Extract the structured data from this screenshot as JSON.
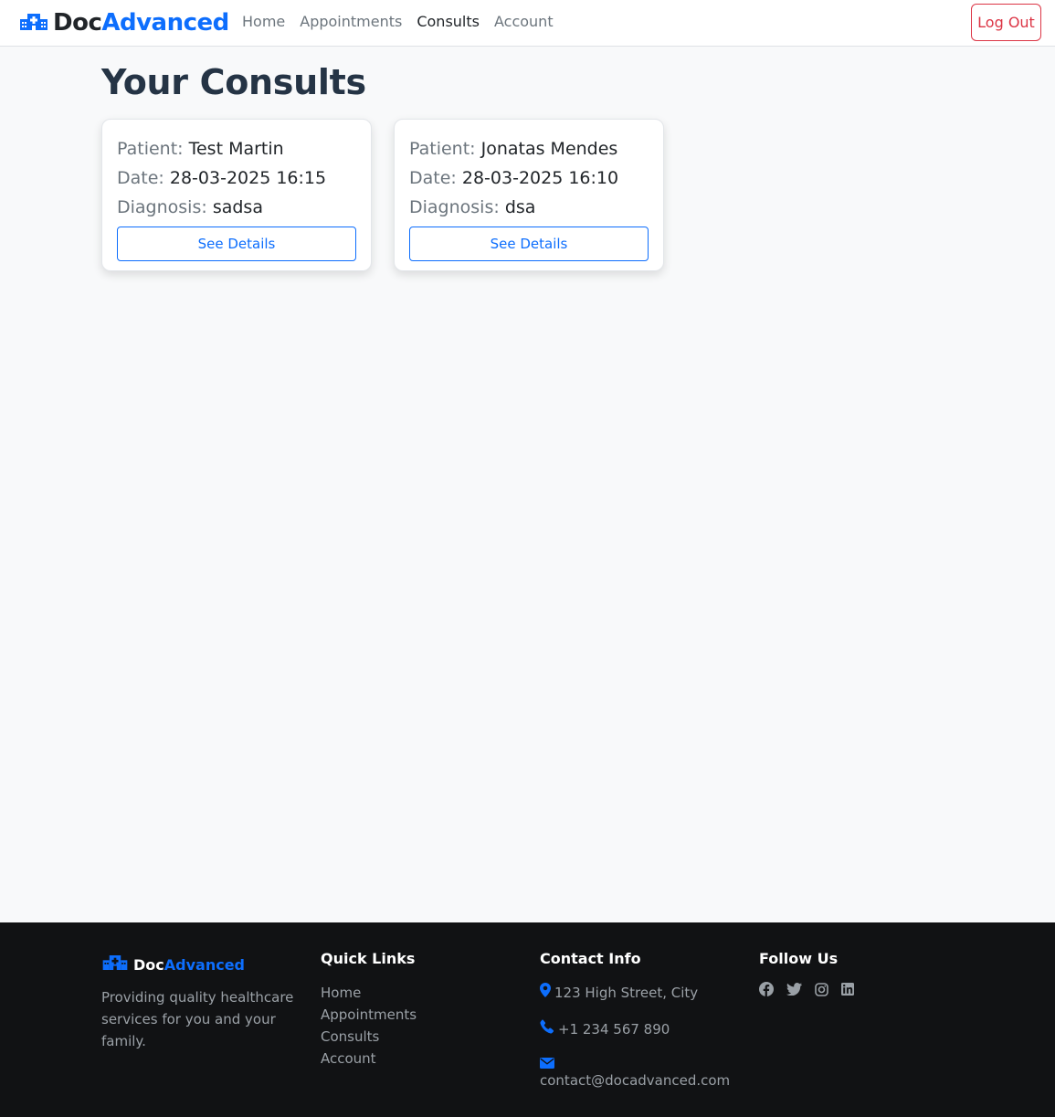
{
  "navbar": {
    "brand_part1": "Doc",
    "brand_part2": "Advanced",
    "links": [
      {
        "label": "Home"
      },
      {
        "label": "Appointments"
      },
      {
        "label": "Consults"
      },
      {
        "label": "Account"
      }
    ],
    "logout_label": "Log Out"
  },
  "main": {
    "title": "Your Consults",
    "cards": [
      {
        "patient_label": "Patient:",
        "patient": "Test Martin",
        "date_label": "Date:",
        "date": "28-03-2025 16:15",
        "diagnosis_label": "Diagnosis:",
        "diagnosis": "sadsa",
        "button_label": "See Details"
      },
      {
        "patient_label": "Patient:",
        "patient": "Jonatas Mendes",
        "date_label": "Date:",
        "date": "28-03-2025 16:10",
        "diagnosis_label": "Diagnosis:",
        "diagnosis": "dsa",
        "button_label": "See Details"
      }
    ]
  },
  "footer": {
    "brand_part1": "Doc",
    "brand_part2": "Advanced",
    "description": "Providing quality healthcare services for you and your family.",
    "quick_links_title": "Quick Links",
    "quick_links": [
      {
        "label": "Home"
      },
      {
        "label": "Appointments"
      },
      {
        "label": "Consults"
      },
      {
        "label": "Account"
      }
    ],
    "contact_title": "Contact Info",
    "address": "123 High Street, City",
    "phone": "+1 234 567 890",
    "email": "contact@docadvanced.com",
    "follow_title": "Follow Us",
    "social_icons": [
      "facebook-icon",
      "twitter-icon",
      "instagram-icon",
      "linkedin-icon"
    ]
  },
  "colors": {
    "accent": "#0d6efd",
    "danger": "#dc3545",
    "footer_bg": "#111214"
  }
}
